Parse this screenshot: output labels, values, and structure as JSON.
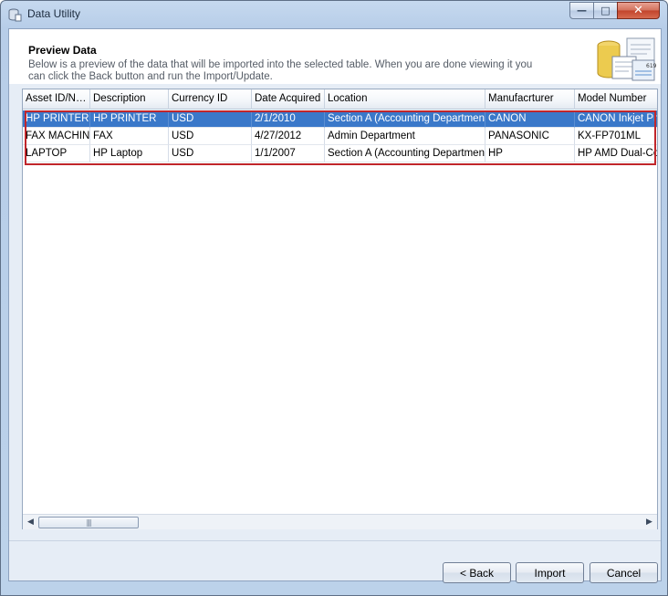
{
  "window": {
    "title": "Data Utility",
    "controls": {
      "minimize": "—",
      "maximize": "□",
      "close": "✕"
    }
  },
  "header": {
    "title": "Preview Data",
    "description": "Below is a preview of the data that will be imported into the selected table.  When you are done viewing it you can click the Back button and run the Import/Update.",
    "graphic_number": "619"
  },
  "grid": {
    "columns": [
      "Asset ID/Na...",
      "Description",
      "Currency ID",
      "Date Acquired",
      "Location",
      "Manufacrturer",
      "Model Number"
    ],
    "rows": [
      [
        "HP PRINTER",
        "HP PRINTER",
        "USD",
        "2/1/2010",
        "Section A (Accounting Department)",
        "CANON",
        "CANON Inkjet Printer"
      ],
      [
        "FAX MACHINE",
        "FAX",
        "USD",
        "4/27/2012",
        "Admin Department",
        "PANASONIC",
        "KX-FP701ML"
      ],
      [
        "LAPTOP",
        "HP Laptop",
        "USD",
        "1/1/2007",
        "Section A (Accounting Department)",
        "HP",
        "HP AMD Dual-Core"
      ]
    ],
    "selected_row": 0
  },
  "scrollbar": {
    "left_arrow": "◀",
    "right_arrow": "▶",
    "thumb_grip": "|||"
  },
  "footer": {
    "back_label": "< Back",
    "import_label": "Import",
    "cancel_label": "Cancel"
  },
  "colors": {
    "selection": "#3a78c9",
    "highlight_border": "#c0262b"
  }
}
